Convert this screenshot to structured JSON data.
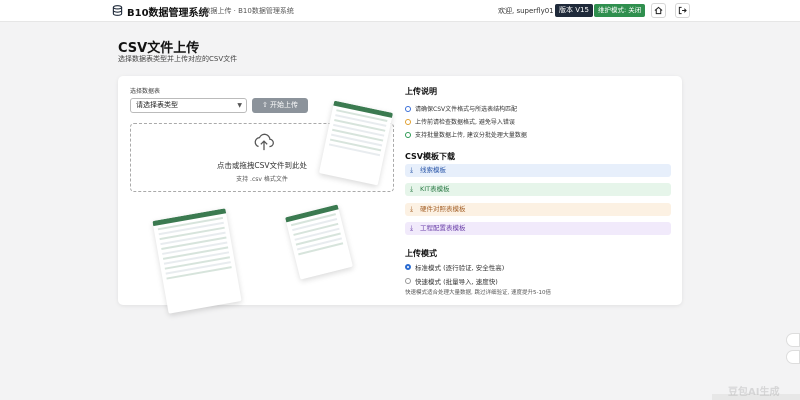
{
  "header": {
    "brand": "B10数据管理系统",
    "breadcrumb": "· 数据上传 · B10数据管理系统",
    "welcome": "欢迎, superfly01",
    "version_badge": "版本 V15",
    "maintenance_badge": "维护模式: 关闭",
    "home_icon": "home-icon",
    "logout_icon": "logout-icon"
  },
  "page": {
    "title": "CSV文件上传",
    "subtitle": "选择数据表类型并上传对应的CSV文件"
  },
  "upload": {
    "select_label": "选择数据表",
    "select_value": "请选择表类型",
    "upload_button": "开始上传",
    "dropzone_main": "点击或拖拽CSV文件到此处",
    "dropzone_sub": "支持 .csv 格式文件"
  },
  "instructions": {
    "title": "上传说明",
    "notes": [
      {
        "text": "请确保CSV文件格式与所选表结构匹配",
        "color": "#3a6fd8"
      },
      {
        "text": "上传前请检查数据格式, 避免导入错误",
        "color": "#e0a030"
      },
      {
        "text": "支持批量数据上传, 建议分批处理大量数据",
        "color": "#2f9a55"
      }
    ]
  },
  "templates": {
    "title": "CSV模板下载",
    "items": [
      {
        "label": "线索模板",
        "bg": "#e7effb",
        "fg": "#2a56a8"
      },
      {
        "label": "KIT表模板",
        "bg": "#e6f5ea",
        "fg": "#2b7a45"
      },
      {
        "label": "硬件对照表模板",
        "bg": "#fcf1e3",
        "fg": "#a5622a"
      },
      {
        "label": "工程配置表模板",
        "bg": "#f1eafb",
        "fg": "#6a3fa8"
      }
    ]
  },
  "mode": {
    "title": "上传模式",
    "options": [
      {
        "label": "标准模式 (逐行验证, 安全性高)",
        "selected": true
      },
      {
        "label": "快速模式 (批量导入, 速度快)",
        "selected": false
      }
    ],
    "note": "快速模式适合处理大量数据, 跳过详细验证, 速度提升5-10倍"
  },
  "watermark": "豆包AI生成",
  "colors": {
    "accent": "#2a6bd1",
    "dark_badge": "#1f2a3a",
    "green_badge": "#2f8f4e",
    "upload_button": "#8c939b"
  }
}
